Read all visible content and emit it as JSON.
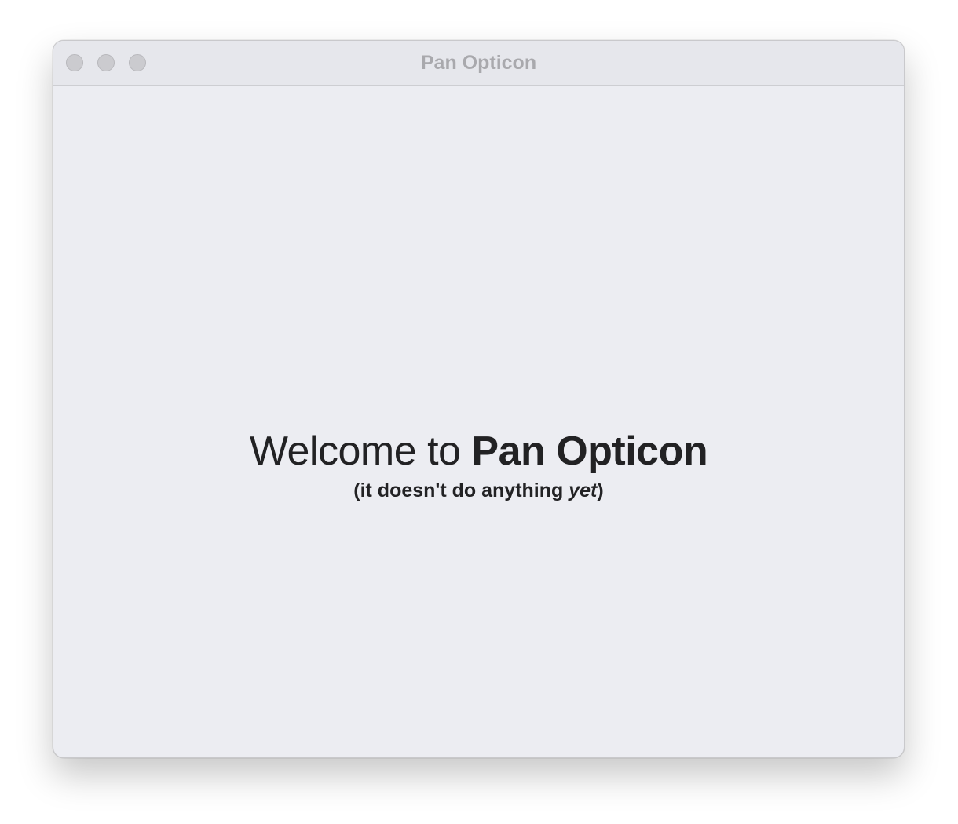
{
  "window": {
    "title": "Pan Opticon"
  },
  "traffic_lights": {
    "close_icon": "close-icon",
    "minimize_icon": "minimize-icon",
    "maximize_icon": "maximize-icon"
  },
  "welcome": {
    "prefix": "Welcome to ",
    "app_name": "Pan Opticon",
    "sub_open": "(it doesn't do anything ",
    "sub_emphasis": "yet",
    "sub_close": ")"
  },
  "colors": {
    "window_bg": "#ecedf2",
    "titlebar_bg": "#e6e7ec",
    "title_text": "#a9a9ad",
    "body_text": "#222224",
    "traffic_inactive": "#cbcbcf"
  }
}
